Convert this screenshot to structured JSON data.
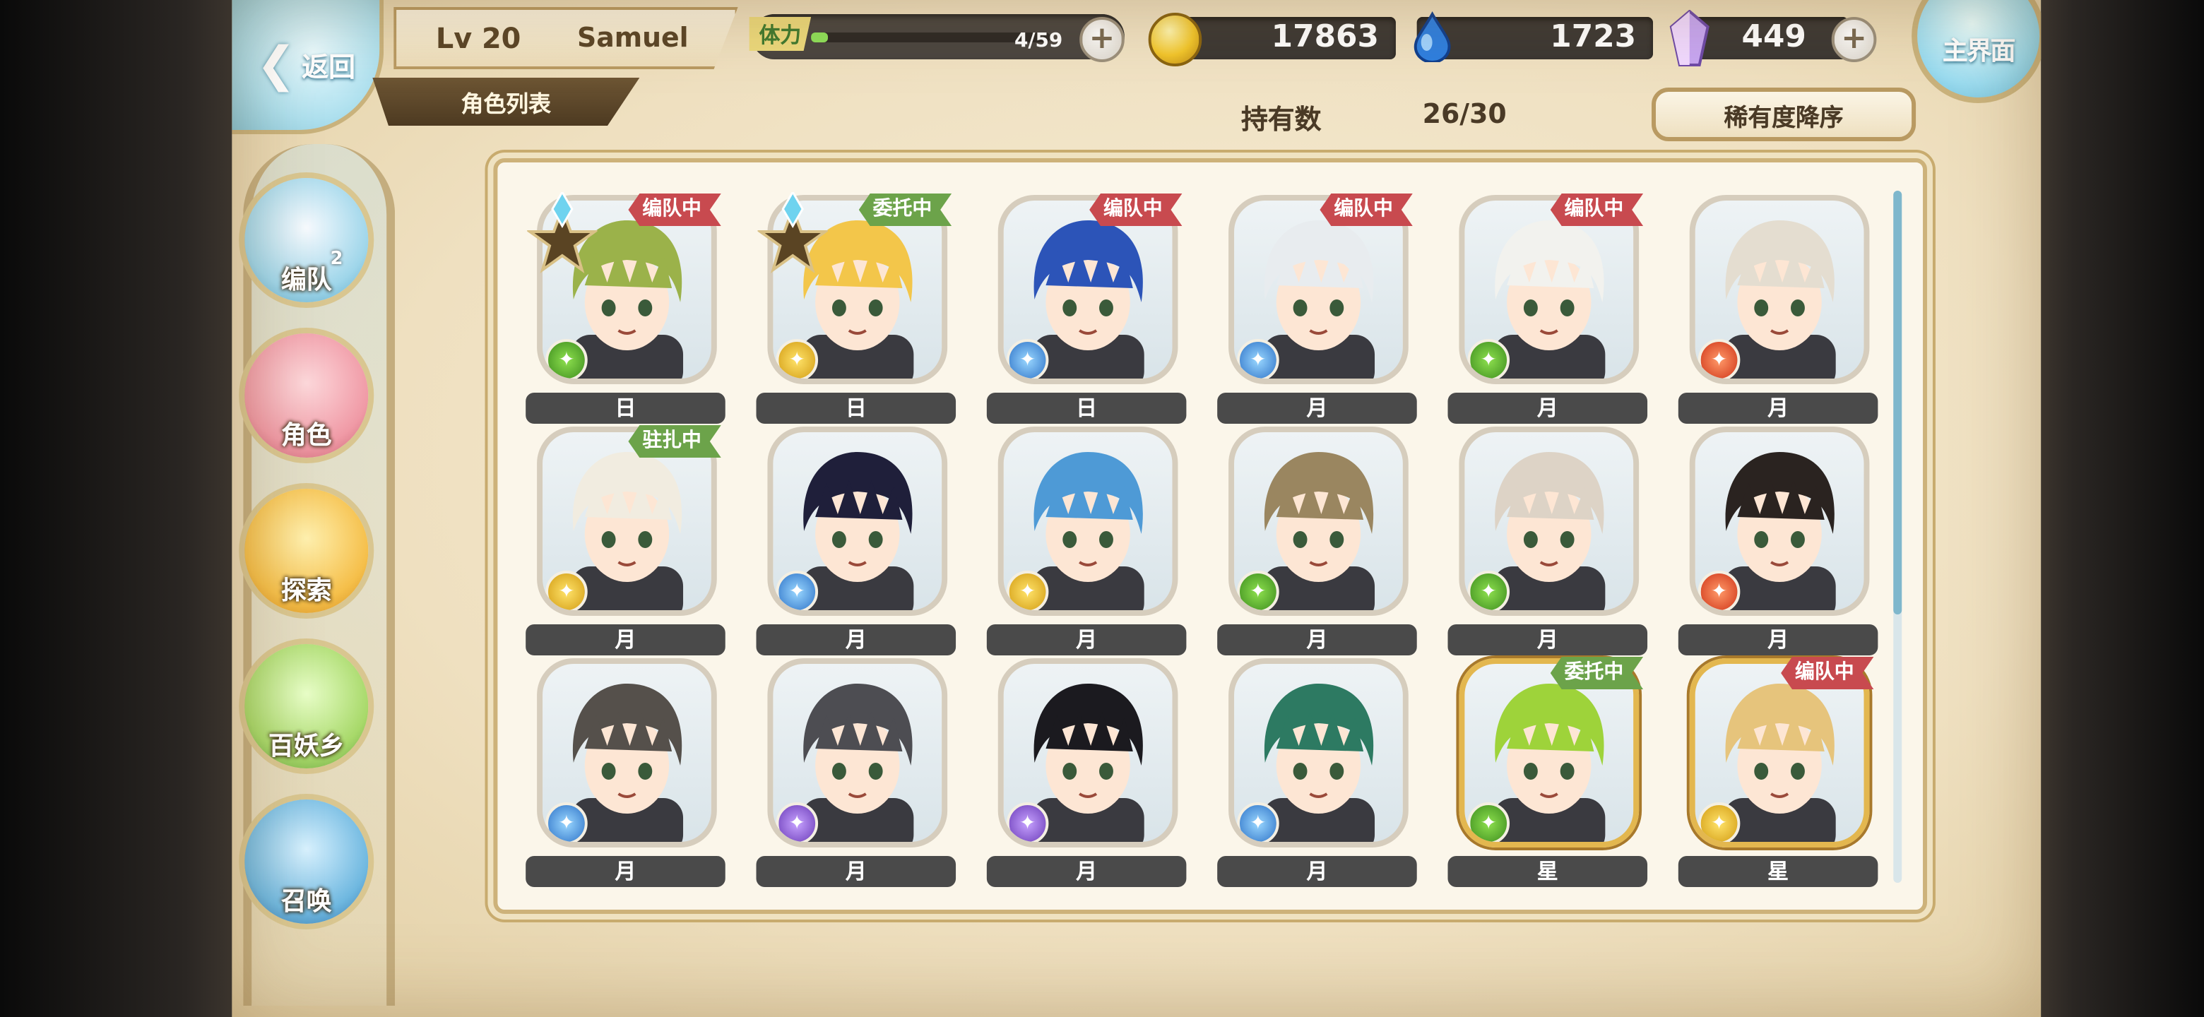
{
  "header": {
    "back_label": "返回",
    "level": "Lv 20",
    "player_name": "Samuel",
    "section_title": "角色列表",
    "stamina_label": "体力",
    "stamina_value": "4/59",
    "stamina_fraction": 0.068,
    "gold": "17863",
    "soul": "1723",
    "crystal": "449",
    "home_label": "主界面"
  },
  "roster": {
    "count_label": "持有数",
    "count_value": "26/30",
    "sort_label": "稀有度降序"
  },
  "nav": [
    {
      "label": "编队",
      "badge": "2",
      "icon": "ghost-knight-icon"
    },
    {
      "label": "角色",
      "icon": "character-girl-icon"
    },
    {
      "label": "探索",
      "icon": "scroll-map-icon"
    },
    {
      "label": "百妖乡",
      "icon": "village-house-icon"
    },
    {
      "label": "召唤",
      "icon": "summon-vortex-icon"
    }
  ],
  "cards": [
    {
      "grade": "日",
      "status": "编队中",
      "attr": "green",
      "star": true,
      "hair": "#9bb24a"
    },
    {
      "grade": "日",
      "status": "委托中",
      "attr": "yellow",
      "star": true,
      "hair": "#f3c64a"
    },
    {
      "grade": "日",
      "status": "编队中",
      "attr": "blue",
      "star": false,
      "hair": "#2c54b8"
    },
    {
      "grade": "月",
      "status": "编队中",
      "attr": "blue",
      "star": false,
      "hair": "#e8ecef"
    },
    {
      "grade": "月",
      "status": "编队中",
      "attr": "green",
      "star": false,
      "hair": "#f2f2ee"
    },
    {
      "grade": "月",
      "status": "",
      "attr": "red",
      "star": false,
      "hair": "#e4ddd0"
    },
    {
      "grade": "月",
      "status": "驻扎中",
      "attr": "yellow",
      "star": false,
      "hair": "#f1ece0"
    },
    {
      "grade": "月",
      "status": "",
      "attr": "blue",
      "star": false,
      "hair": "#1f1f3a"
    },
    {
      "grade": "月",
      "status": "",
      "attr": "yellow",
      "star": false,
      "hair": "#4e9ad6"
    },
    {
      "grade": "月",
      "status": "",
      "attr": "green",
      "star": false,
      "hair": "#9a8660"
    },
    {
      "grade": "月",
      "status": "",
      "attr": "green",
      "star": false,
      "hair": "#ddd3c6"
    },
    {
      "grade": "月",
      "status": "",
      "attr": "red",
      "star": false,
      "hair": "#2a2320"
    },
    {
      "grade": "月",
      "status": "",
      "attr": "blue",
      "star": false,
      "hair": "#55504b"
    },
    {
      "grade": "月",
      "status": "",
      "attr": "purple",
      "star": false,
      "hair": "#4d4d52"
    },
    {
      "grade": "月",
      "status": "",
      "attr": "purple",
      "star": false,
      "hair": "#1b1a1f"
    },
    {
      "grade": "月",
      "status": "",
      "attr": "blue",
      "star": false,
      "hair": "#2d7a62"
    },
    {
      "grade": "星",
      "status": "委托中",
      "attr": "green",
      "star": false,
      "hair": "#9ed33a"
    },
    {
      "grade": "星",
      "status": "编队中",
      "attr": "yellow",
      "star": false,
      "hair": "#e6c47c"
    }
  ],
  "status_colors": {
    "编队中": "#c84a4f",
    "委托中": "#6ca34a",
    "驻扎中": "#6ca34a"
  }
}
